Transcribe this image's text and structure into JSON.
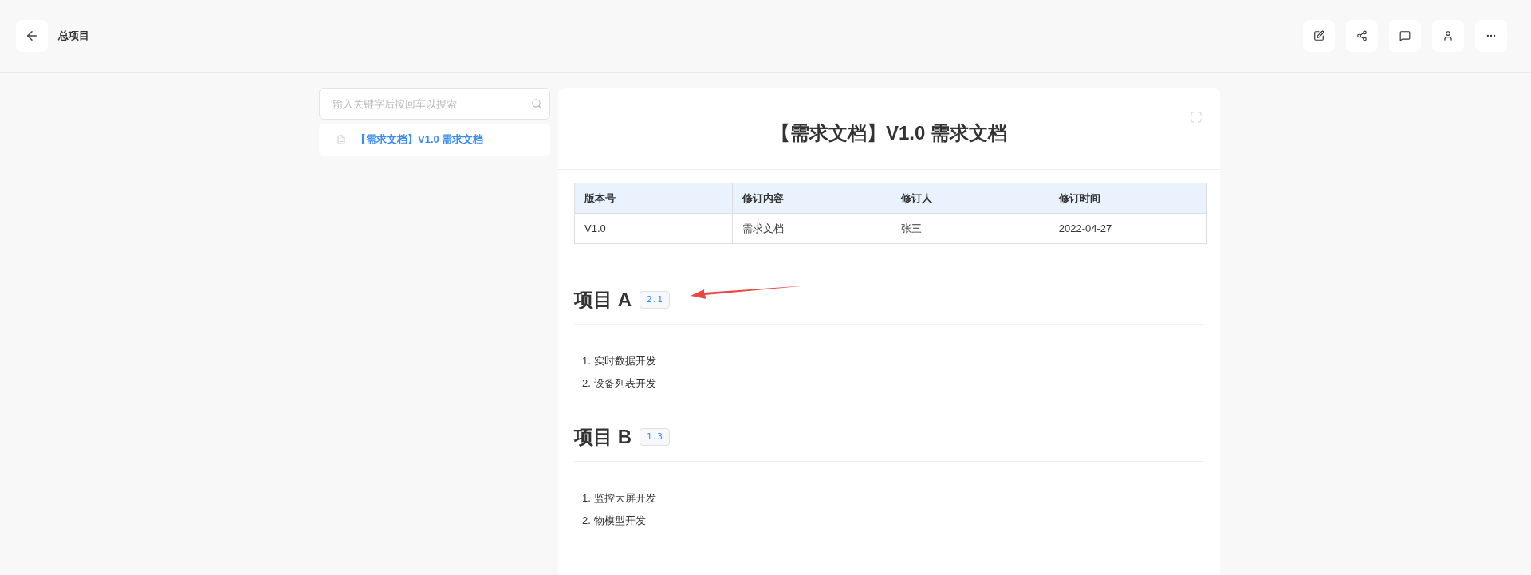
{
  "header": {
    "title": "总项目",
    "actions": [
      {
        "kind": "edit"
      },
      {
        "kind": "share"
      },
      {
        "kind": "comment"
      },
      {
        "kind": "user"
      },
      {
        "kind": "more"
      }
    ]
  },
  "sidebar": {
    "search": {
      "placeholder": "输入关键字后按回车以搜索"
    },
    "items": [
      {
        "label": "【需求文档】V1.0 需求文档",
        "selected": true
      }
    ]
  },
  "document": {
    "title": "【需求文档】V1.0 需求文档",
    "table": {
      "columns": [
        "版本号",
        "修订内容",
        "修订人",
        "修订时间"
      ],
      "rows": [
        [
          "V1.0",
          "需求文档",
          "张三",
          "2022-04-27"
        ]
      ]
    },
    "sections": [
      {
        "heading": "项目 A",
        "tag": "2.1",
        "annotated": true,
        "items": [
          {
            "number": "1.",
            "text": "实时数据开发"
          },
          {
            "number": "2.",
            "text": "设备列表开发"
          }
        ]
      },
      {
        "heading": "项目 B",
        "tag": "1.3",
        "annotated": false,
        "items": [
          {
            "number": "1.",
            "text": "监控大屏开发"
          },
          {
            "number": "2.",
            "text": "物模型开发"
          }
        ]
      }
    ]
  }
}
